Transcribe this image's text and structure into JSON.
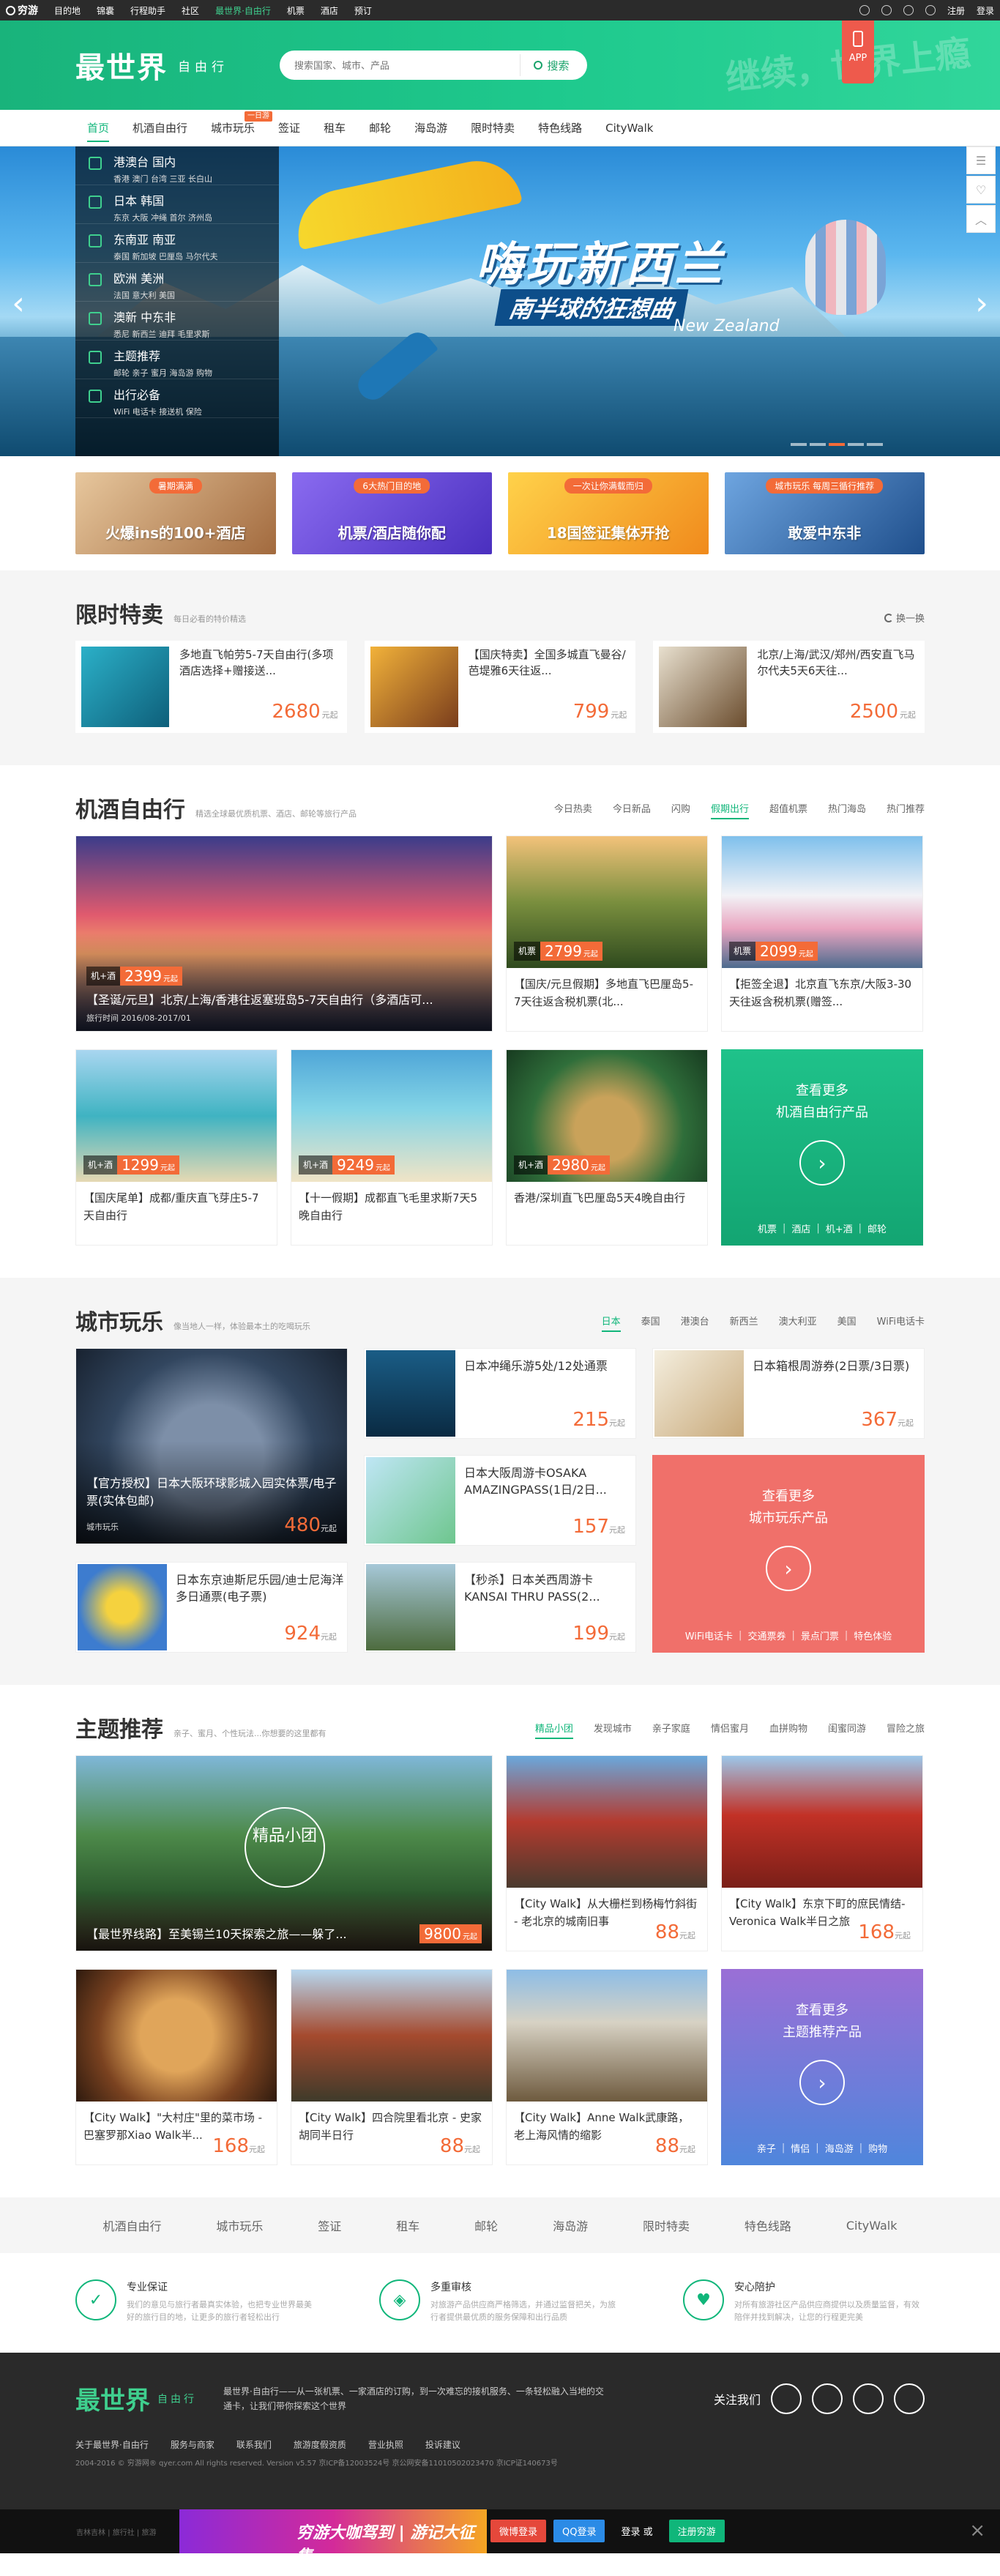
{
  "topbar": {
    "logo": "穷游",
    "links": [
      "目的地",
      "锦囊",
      "行程助手",
      "社区",
      "最世界·自由行",
      "机票",
      "酒店",
      "预订"
    ],
    "right": [
      "注册",
      "登录"
    ]
  },
  "header": {
    "logo": "最世界",
    "sub": "自由行",
    "search_placeholder": "搜索国家、城市、产品",
    "search_button": "搜索",
    "deco": "继续，世界上瘾",
    "app_label": "APP"
  },
  "nav": {
    "items": [
      "首页",
      "机酒自由行",
      "城市玩乐",
      "签证",
      "租车",
      "邮轮",
      "海岛游",
      "限时特卖",
      "特色线路",
      "CityWalk"
    ],
    "badge": "一日游"
  },
  "banner": {
    "title": "嗨玩新西兰",
    "subtitle": "南半球的狂想曲",
    "en": "New Zealand",
    "slides": 5,
    "active_slide": 2,
    "menu": [
      {
        "title": "港澳台 国内",
        "sub": "香港 澳门 台湾 三亚 长白山"
      },
      {
        "title": "日本 韩国",
        "sub": "东京 大阪 冲绳 首尔 济州岛"
      },
      {
        "title": "东南亚 南亚",
        "sub": "泰国 新加坡 巴厘岛 马尔代夫"
      },
      {
        "title": "欧洲 美洲",
        "sub": "法国 意大利 美国"
      },
      {
        "title": "澳新 中东非",
        "sub": "悉尼 新西兰 迪拜 毛里求斯"
      },
      {
        "title": "主题推荐",
        "sub": "邮轮 亲子 蜜月 海岛游 购物"
      },
      {
        "title": "出行必备",
        "sub": "WiFi 电话卡 接送机 保险"
      }
    ]
  },
  "promos": [
    {
      "tag": "暑期满满",
      "text": "火爆ins的100+酒店",
      "color": "#c98a5a"
    },
    {
      "tag": "6大热门目的地",
      "text": "机票/酒店随你配",
      "color": "#6b4fd6"
    },
    {
      "tag": "一次让你满载而归",
      "text": "18国签证集体开抢",
      "color": "#f0a31c"
    },
    {
      "tag": "城市玩乐 每周三循行推荐",
      "text": "敢爱中东非",
      "color": "#3d7bc4"
    }
  ],
  "flash": {
    "title": "限时特卖",
    "sub": "每日必看的特价精选",
    "refresh": "换一换",
    "items": [
      {
        "name": "多地直飞帕劳5-7天自由行(多项酒店选择+赠接送...",
        "price": "2680",
        "unit": "元起"
      },
      {
        "name": "【国庆特卖】全国多城直飞曼谷/芭堤雅6天往返...",
        "price": "799",
        "unit": "元起"
      },
      {
        "name": "北京/上海/武汉/郑州/西安直飞马尔代夫5天6天往...",
        "price": "2500",
        "unit": "元起"
      }
    ]
  },
  "flights": {
    "title": "机酒自由行",
    "sub": "精选全球最优质机票、酒店、邮轮等旅行产品",
    "tabs": [
      "今日热卖",
      "今日新品",
      "闪购",
      "假期出行",
      "超值机票",
      "热门海岛",
      "热门推荐"
    ],
    "active_tab": 3,
    "items": [
      {
        "kind": "机+酒",
        "price": "2399",
        "name": "【圣诞/元旦】北京/上海/香港往返塞班岛5-7天自由行（多酒店可...",
        "date": "旅行时间 2016/08-2017/01"
      },
      {
        "kind": "机票",
        "price": "2799",
        "name": "【国庆/元旦假期】多地直飞巴厘岛5-7天往返含税机票(北..."
      },
      {
        "kind": "机票",
        "price": "2099",
        "name": "【拒签全退】北京直飞东京/大阪3-30天往返含税机票(赠签..."
      },
      {
        "kind": "机+酒",
        "price": "1299",
        "name": "【国庆尾单】成都/重庆直飞芽庄5-7天自由行"
      },
      {
        "kind": "机+酒",
        "price": "9249",
        "name": "【十一假期】成都直飞毛里求斯7天5晚自由行"
      },
      {
        "kind": "机+酒",
        "price": "2980",
        "name": "香港/深圳直飞巴厘岛5天4晚自由行"
      }
    ],
    "more": {
      "line1": "查看更多",
      "line2": "机酒自由行产品",
      "links": [
        "机票",
        "酒店",
        "机+酒",
        "邮轮"
      ]
    }
  },
  "city": {
    "title": "城市玩乐",
    "sub": "像当地人一样，体验最本土的吃喝玩乐",
    "tabs": [
      "日本",
      "泰国",
      "港澳台",
      "新西兰",
      "澳大利亚",
      "美国",
      "WiFi电话卡"
    ],
    "active_tab": 0,
    "big": {
      "name": "【官方授权】日本大阪环球影城入园实体票/电子票(实体包邮)",
      "tag": "城市玩乐",
      "price": "480"
    },
    "items": [
      {
        "name": "日本冲绳乐游5处/12处通票",
        "price": "215"
      },
      {
        "name": "日本箱根周游券(2日票/3日票)",
        "price": "367"
      },
      {
        "name": "日本大阪周游卡OSAKA AMAZINGPASS(1日/2日...",
        "price": "157"
      },
      {
        "name": "日本东京迪斯尼乐园/迪士尼海洋多日通票(电子票)",
        "price": "924"
      },
      {
        "name": "【秒杀】日本关西周游卡 KANSAI THRU PASS(2...",
        "price": "199"
      }
    ],
    "unit": "元起",
    "more": {
      "line1": "查看更多",
      "line2": "城市玩乐产品",
      "links": [
        "WiFi电话卡",
        "交通票券",
        "景点门票",
        "特色体验"
      ]
    }
  },
  "theme": {
    "title": "主题推荐",
    "sub": "亲子、蜜月、个性玩法...你想要的这里都有",
    "tabs": [
      "精品小团",
      "发现城市",
      "亲子家庭",
      "情侣蜜月",
      "血拼购物",
      "闺蜜同游",
      "冒险之旅"
    ],
    "active_tab": 0,
    "stamp": "精品小团",
    "big": {
      "name": "【最世界线路】至美锡兰10天探索之旅——躲了...",
      "price": "9800"
    },
    "items": [
      {
        "name": "【City Walk】从大栅栏到杨梅竹斜街 - 老北京的城南旧事",
        "price": "88"
      },
      {
        "name": "【City Walk】东京下町的庶民情结- Veronica Walk半日之旅",
        "price": "168"
      },
      {
        "name": "【City Walk】\"大村庄\"里的菜市场 - 巴塞罗那Xiao Walk半...",
        "price": "168"
      },
      {
        "name": "【City Walk】四合院里看北京 - 史家胡同半日行",
        "price": "88"
      },
      {
        "name": "【City Walk】Anne Walk武康路，老上海风情的缩影",
        "price": "88"
      }
    ],
    "unit": "元起",
    "more": {
      "line1": "查看更多",
      "line2": "主题推荐产品",
      "links": [
        "亲子",
        "情侣",
        "海岛游",
        "购物"
      ]
    }
  },
  "bottom_nav": [
    "机酒自由行",
    "城市玩乐",
    "签证",
    "租车",
    "邮轮",
    "海岛游",
    "限时特卖",
    "特色线路",
    "CityWalk"
  ],
  "guarantees": [
    {
      "title": "专业保证",
      "desc": "我们的意见与旅行者最真实体验，也把专业世界最美好的旅行目的地，让更多的旅行者轻松出行"
    },
    {
      "title": "多重审核",
      "desc": "对旅游产品供应商严格筛选，并通过监督把关，为旅行者提供最优质的服务保障和出行品质"
    },
    {
      "title": "安心陪护",
      "desc": "对所有旅游社区产品供应商提供以及质量监督，有效陪伴并找到解决，让您的行程更完美"
    }
  ],
  "footer": {
    "logo": "最世界",
    "sub": "自由行",
    "desc": "最世界·自由行——从一张机票、一家酒店的订购，到一次难忘的接机服务、一条轻松融入当地的交通卡，让我们带你探索这个世界",
    "follow": "关注我们",
    "links": [
      "关于最世界·自由行",
      "服务与商家",
      "联系我们",
      "旅游度假资质",
      "营业执照",
      "投诉建议"
    ],
    "copyright": "2004-2016 © 穷游网® qyer.com All rights reserved. Version v5.57 京ICP备12003524号 京公网安备11010502023470 京ICP证140673号"
  },
  "bottom_bar": {
    "small": "吉林吉林 | 旅行社 | 旅游",
    "ad": "穷游大咖驾到 | 游记大征集",
    "login_weibo": "微博登录",
    "login_qq": "QQ登录",
    "or": "登录 或",
    "register": "注册穷游"
  }
}
